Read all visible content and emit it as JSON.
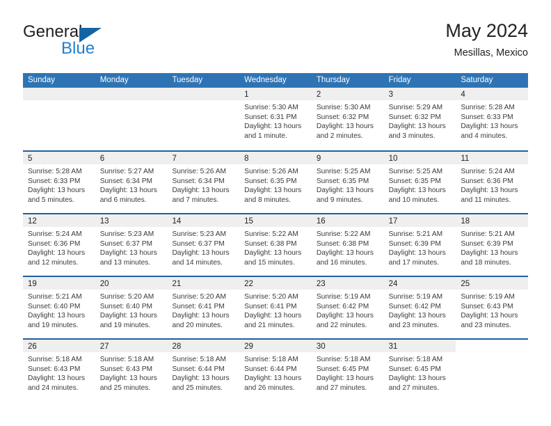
{
  "brand": {
    "word1": "General",
    "word2": "Blue",
    "mark_icon": "triangle-flag-icon",
    "accent_color": "#1f7fd0",
    "mark_color": "#1464a5"
  },
  "header": {
    "title": "May 2024",
    "subtitle": "Mesillas, Mexico"
  },
  "calendar": {
    "header_bg": "#2e74b5",
    "row_divider": "#1f5fa0",
    "datestrip_bg": "#efefef",
    "weekdays": [
      "Sunday",
      "Monday",
      "Tuesday",
      "Wednesday",
      "Thursday",
      "Friday",
      "Saturday"
    ],
    "weeks": [
      [
        {
          "day": "",
          "lines": [],
          "empty": true
        },
        {
          "day": "",
          "lines": [],
          "empty": true
        },
        {
          "day": "",
          "lines": [],
          "empty": true
        },
        {
          "day": "1",
          "lines": [
            "Sunrise: 5:30 AM",
            "Sunset: 6:31 PM",
            "Daylight: 13 hours",
            "and 1 minute."
          ]
        },
        {
          "day": "2",
          "lines": [
            "Sunrise: 5:30 AM",
            "Sunset: 6:32 PM",
            "Daylight: 13 hours",
            "and 2 minutes."
          ]
        },
        {
          "day": "3",
          "lines": [
            "Sunrise: 5:29 AM",
            "Sunset: 6:32 PM",
            "Daylight: 13 hours",
            "and 3 minutes."
          ]
        },
        {
          "day": "4",
          "lines": [
            "Sunrise: 5:28 AM",
            "Sunset: 6:33 PM",
            "Daylight: 13 hours",
            "and 4 minutes."
          ]
        }
      ],
      [
        {
          "day": "5",
          "lines": [
            "Sunrise: 5:28 AM",
            "Sunset: 6:33 PM",
            "Daylight: 13 hours",
            "and 5 minutes."
          ]
        },
        {
          "day": "6",
          "lines": [
            "Sunrise: 5:27 AM",
            "Sunset: 6:34 PM",
            "Daylight: 13 hours",
            "and 6 minutes."
          ]
        },
        {
          "day": "7",
          "lines": [
            "Sunrise: 5:26 AM",
            "Sunset: 6:34 PM",
            "Daylight: 13 hours",
            "and 7 minutes."
          ]
        },
        {
          "day": "8",
          "lines": [
            "Sunrise: 5:26 AM",
            "Sunset: 6:35 PM",
            "Daylight: 13 hours",
            "and 8 minutes."
          ]
        },
        {
          "day": "9",
          "lines": [
            "Sunrise: 5:25 AM",
            "Sunset: 6:35 PM",
            "Daylight: 13 hours",
            "and 9 minutes."
          ]
        },
        {
          "day": "10",
          "lines": [
            "Sunrise: 5:25 AM",
            "Sunset: 6:35 PM",
            "Daylight: 13 hours",
            "and 10 minutes."
          ]
        },
        {
          "day": "11",
          "lines": [
            "Sunrise: 5:24 AM",
            "Sunset: 6:36 PM",
            "Daylight: 13 hours",
            "and 11 minutes."
          ]
        }
      ],
      [
        {
          "day": "12",
          "lines": [
            "Sunrise: 5:24 AM",
            "Sunset: 6:36 PM",
            "Daylight: 13 hours",
            "and 12 minutes."
          ]
        },
        {
          "day": "13",
          "lines": [
            "Sunrise: 5:23 AM",
            "Sunset: 6:37 PM",
            "Daylight: 13 hours",
            "and 13 minutes."
          ]
        },
        {
          "day": "14",
          "lines": [
            "Sunrise: 5:23 AM",
            "Sunset: 6:37 PM",
            "Daylight: 13 hours",
            "and 14 minutes."
          ]
        },
        {
          "day": "15",
          "lines": [
            "Sunrise: 5:22 AM",
            "Sunset: 6:38 PM",
            "Daylight: 13 hours",
            "and 15 minutes."
          ]
        },
        {
          "day": "16",
          "lines": [
            "Sunrise: 5:22 AM",
            "Sunset: 6:38 PM",
            "Daylight: 13 hours",
            "and 16 minutes."
          ]
        },
        {
          "day": "17",
          "lines": [
            "Sunrise: 5:21 AM",
            "Sunset: 6:39 PM",
            "Daylight: 13 hours",
            "and 17 minutes."
          ]
        },
        {
          "day": "18",
          "lines": [
            "Sunrise: 5:21 AM",
            "Sunset: 6:39 PM",
            "Daylight: 13 hours",
            "and 18 minutes."
          ]
        }
      ],
      [
        {
          "day": "19",
          "lines": [
            "Sunrise: 5:21 AM",
            "Sunset: 6:40 PM",
            "Daylight: 13 hours",
            "and 19 minutes."
          ]
        },
        {
          "day": "20",
          "lines": [
            "Sunrise: 5:20 AM",
            "Sunset: 6:40 PM",
            "Daylight: 13 hours",
            "and 19 minutes."
          ]
        },
        {
          "day": "21",
          "lines": [
            "Sunrise: 5:20 AM",
            "Sunset: 6:41 PM",
            "Daylight: 13 hours",
            "and 20 minutes."
          ]
        },
        {
          "day": "22",
          "lines": [
            "Sunrise: 5:20 AM",
            "Sunset: 6:41 PM",
            "Daylight: 13 hours",
            "and 21 minutes."
          ]
        },
        {
          "day": "23",
          "lines": [
            "Sunrise: 5:19 AM",
            "Sunset: 6:42 PM",
            "Daylight: 13 hours",
            "and 22 minutes."
          ]
        },
        {
          "day": "24",
          "lines": [
            "Sunrise: 5:19 AM",
            "Sunset: 6:42 PM",
            "Daylight: 13 hours",
            "and 23 minutes."
          ]
        },
        {
          "day": "25",
          "lines": [
            "Sunrise: 5:19 AM",
            "Sunset: 6:43 PM",
            "Daylight: 13 hours",
            "and 23 minutes."
          ]
        }
      ],
      [
        {
          "day": "26",
          "lines": [
            "Sunrise: 5:18 AM",
            "Sunset: 6:43 PM",
            "Daylight: 13 hours",
            "and 24 minutes."
          ]
        },
        {
          "day": "27",
          "lines": [
            "Sunrise: 5:18 AM",
            "Sunset: 6:43 PM",
            "Daylight: 13 hours",
            "and 25 minutes."
          ]
        },
        {
          "day": "28",
          "lines": [
            "Sunrise: 5:18 AM",
            "Sunset: 6:44 PM",
            "Daylight: 13 hours",
            "and 25 minutes."
          ]
        },
        {
          "day": "29",
          "lines": [
            "Sunrise: 5:18 AM",
            "Sunset: 6:44 PM",
            "Daylight: 13 hours",
            "and 26 minutes."
          ]
        },
        {
          "day": "30",
          "lines": [
            "Sunrise: 5:18 AM",
            "Sunset: 6:45 PM",
            "Daylight: 13 hours",
            "and 27 minutes."
          ]
        },
        {
          "day": "31",
          "lines": [
            "Sunrise: 5:18 AM",
            "Sunset: 6:45 PM",
            "Daylight: 13 hours",
            "and 27 minutes."
          ]
        },
        {
          "day": "",
          "lines": [],
          "blank": true
        }
      ]
    ]
  }
}
